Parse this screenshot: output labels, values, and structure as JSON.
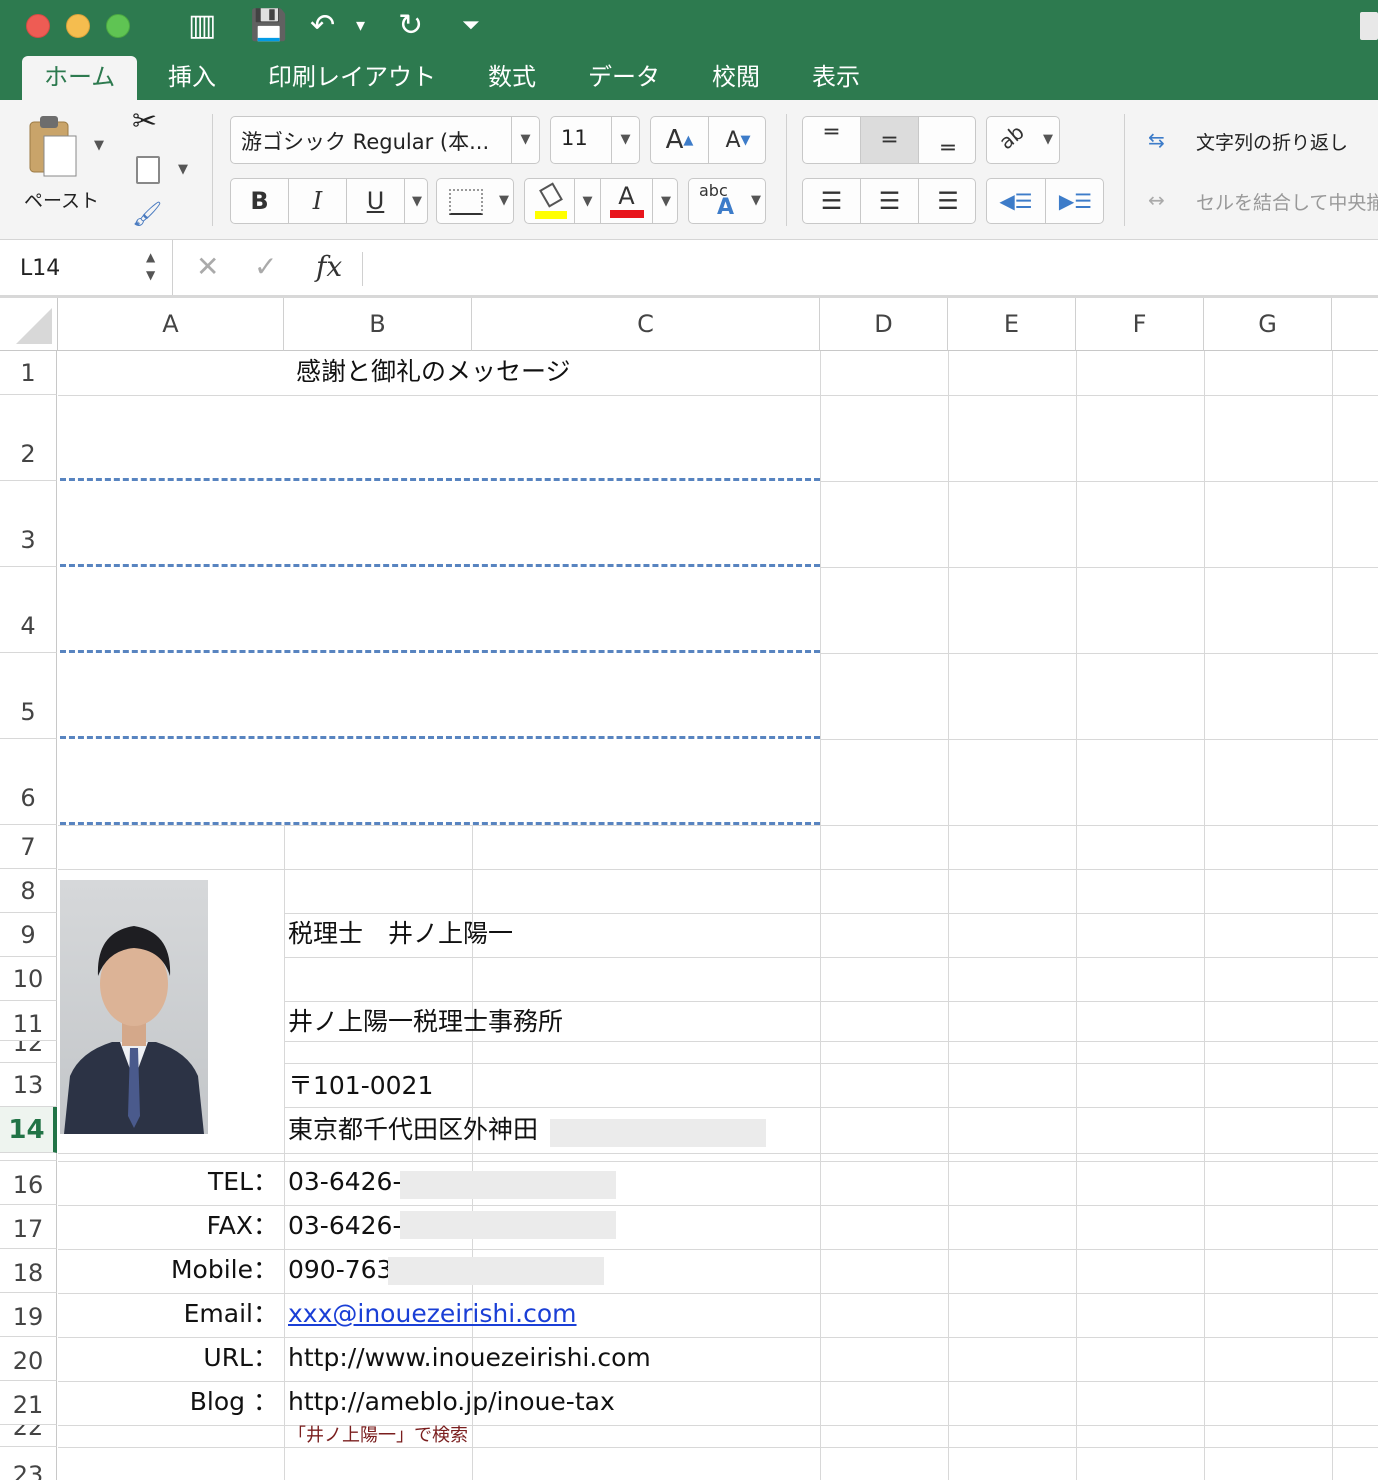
{
  "quick_access": {
    "sidebar": "▥",
    "save": "💾",
    "undo": "↶",
    "undo_caret": "▾",
    "redo": "↻",
    "customize": "⏷"
  },
  "tabs": [
    {
      "label": "ホーム",
      "active": true
    },
    {
      "label": "挿入"
    },
    {
      "label": "印刷レイアウト"
    },
    {
      "label": "数式"
    },
    {
      "label": "データ"
    },
    {
      "label": "校閲"
    },
    {
      "label": "表示"
    }
  ],
  "ribbon": {
    "paste_label": "ペースト",
    "font_name": "游ゴシック Regular (本...",
    "font_size": "11",
    "grow_font": "A",
    "shrink_font": "A",
    "bold": "B",
    "italic": "I",
    "underline": "U",
    "font_color_glyph": "A",
    "phonetic_top": "abc",
    "phonetic_bottom": "A",
    "wrap_text": "文字列の折り返し",
    "merge_center": "セルを結合して中央揃え",
    "colors": {
      "fill": "#ffff00",
      "font": "#e8141b",
      "accent": "#2d7a4f"
    }
  },
  "formula_bar": {
    "name_box": "L14",
    "cancel": "✕",
    "enter": "✓",
    "fx": "fx",
    "formula": ""
  },
  "columns": [
    "A",
    "B",
    "C",
    "D",
    "E",
    "F",
    "G"
  ],
  "rows": [
    "1",
    "2",
    "3",
    "4",
    "5",
    "6",
    "7",
    "8",
    "9",
    "10",
    "11",
    "12",
    "13",
    "14",
    "16",
    "17",
    "18",
    "19",
    "20",
    "21",
    "22",
    "23"
  ],
  "active_row": "14",
  "sheet": {
    "title": "感謝と御礼のメッセージ",
    "name": "税理士　井ノ上陽一",
    "office": "井ノ上陽一税理士事務所",
    "postal": "〒101-0021",
    "address": "東京都千代田区外神田",
    "contacts": [
      {
        "label": "TEL：",
        "value": "03-6426-"
      },
      {
        "label": "FAX：",
        "value": "03-6426-"
      },
      {
        "label": "Mobile：",
        "value": "090-763"
      },
      {
        "label": "Email：",
        "value": "xxx@inouezeirishi.com"
      },
      {
        "label": "URL：",
        "value": "http://www.inouezeirishi.com"
      },
      {
        "label": "Blog ：",
        "value": "http://ameblo.jp/inoue-tax"
      }
    ],
    "search_note": "「井ノ上陽一」で検索",
    "link_color": "#1a3fd6",
    "note_color": "#7a1e1e"
  }
}
